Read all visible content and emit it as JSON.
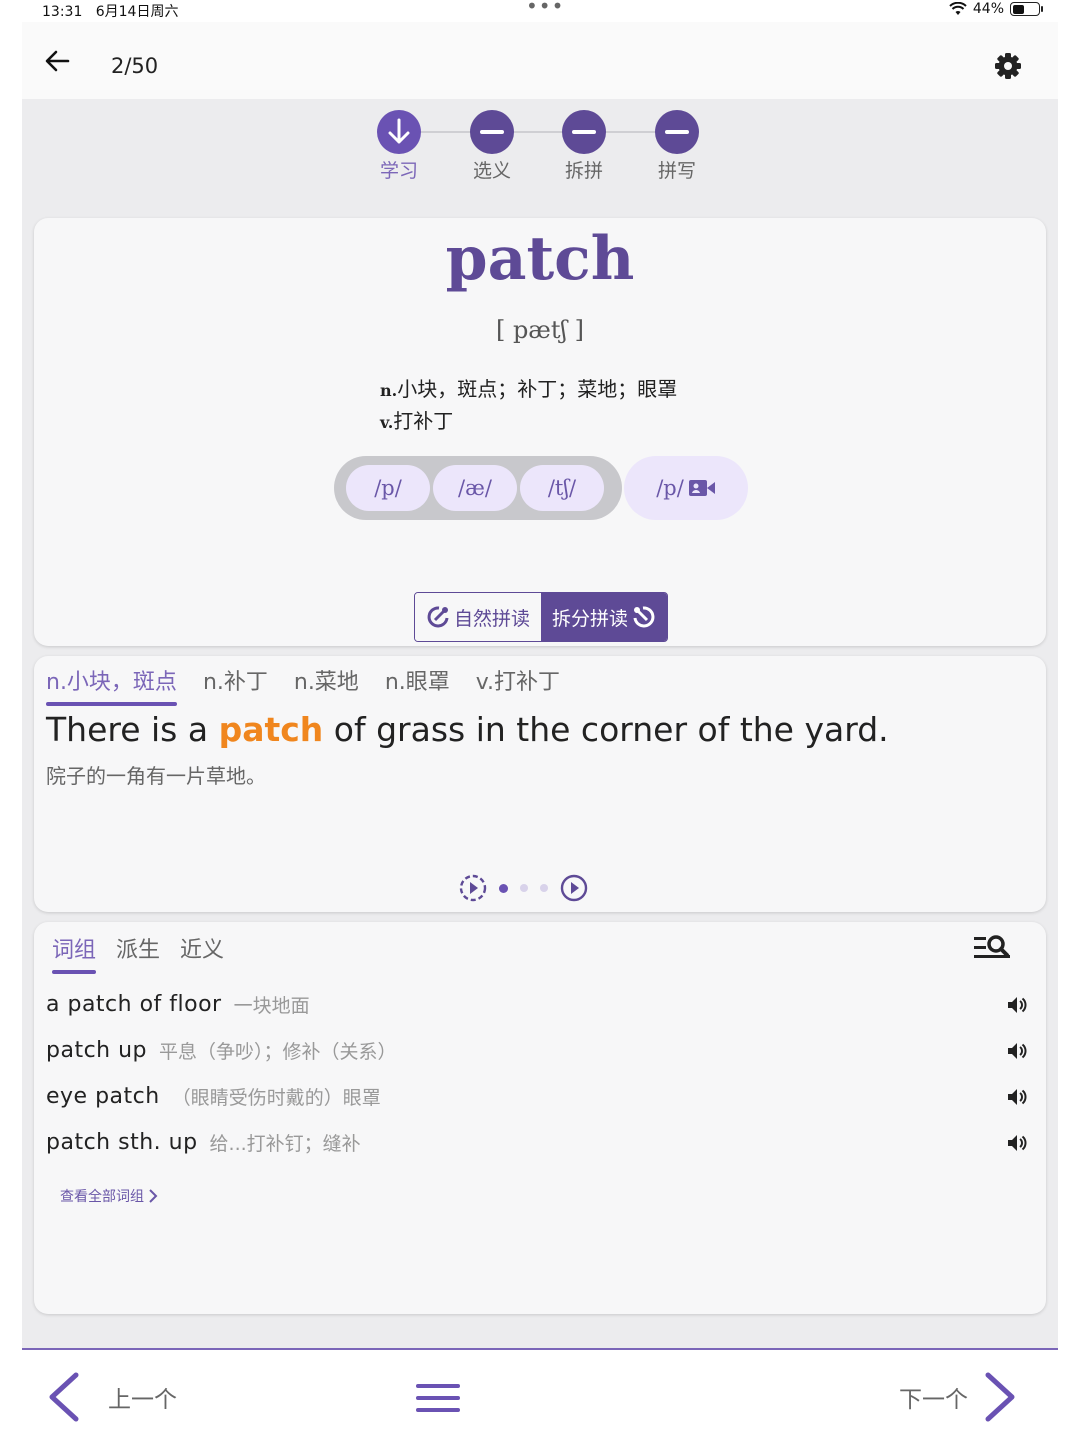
{
  "status": {
    "time": "13:31",
    "date": "6月14日周六",
    "battery": "44%",
    "battery_level": 0.44
  },
  "header": {
    "counter": "2/50"
  },
  "steps": [
    {
      "label": "学习",
      "active": true
    },
    {
      "label": "选义",
      "active": false
    },
    {
      "label": "拆拼",
      "active": false
    },
    {
      "label": "拼写",
      "active": false
    }
  ],
  "word": {
    "text": "patch",
    "phonetic": "[ pætʃ ]",
    "definitions": [
      {
        "pos": "n.",
        "meaning": "小块，斑点；补丁；菜地；眼罩"
      },
      {
        "pos": "v.",
        "meaning": "打补丁"
      }
    ],
    "phonemes": [
      "/p/",
      "/æ/",
      "/tʃ/"
    ],
    "phoneme_video": "/p/",
    "toggle": {
      "natural": "自然拼读",
      "split": "拆分拼读"
    }
  },
  "example": {
    "senses": [
      "n.小块，斑点",
      "n.补丁",
      "n.菜地",
      "n.眼罩",
      "v.打补丁"
    ],
    "sentence_before": "There is a ",
    "sentence_highlight": "patch",
    "sentence_after": " of grass in the corner of the yard.",
    "translation": "院子的一角有一片草地。"
  },
  "phrases": {
    "tabs": [
      "词组",
      "派生",
      "近义"
    ],
    "items": [
      {
        "en": "a patch of floor",
        "zh": "一块地面"
      },
      {
        "en": "patch up",
        "zh": "平息（争吵）；修补（关系）"
      },
      {
        "en": "eye patch",
        "zh": "（眼睛受伤时戴的）眼罩"
      },
      {
        "en": "patch sth. up",
        "zh": "给...打补钉；缝补"
      }
    ],
    "see_all": "查看全部词组"
  },
  "footer": {
    "prev": "上一个",
    "next": "下一个"
  },
  "colors": {
    "accent": "#5e4a96",
    "highlight": "#f0861e",
    "chip_bg": "#ece6fb"
  }
}
